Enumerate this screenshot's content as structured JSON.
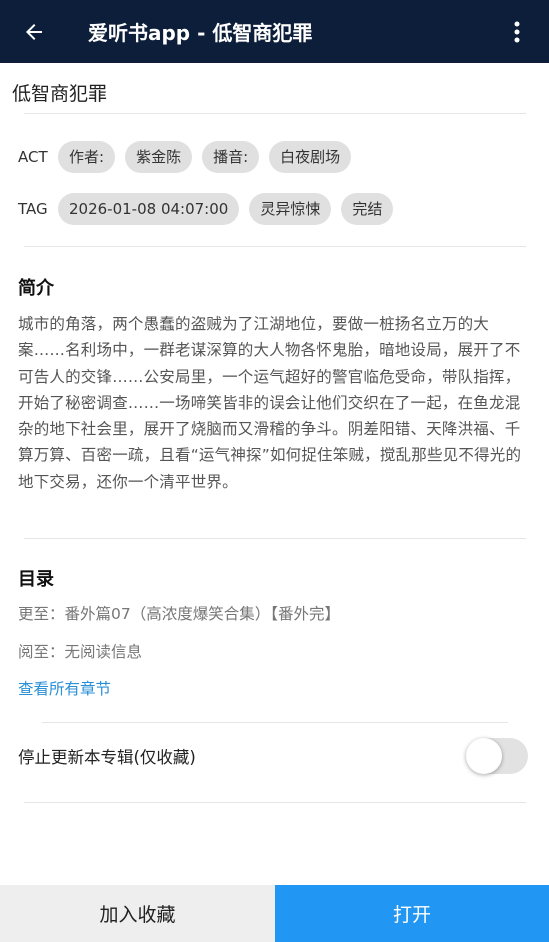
{
  "appbar": {
    "title": "爱听书app - 低智商犯罪",
    "back_icon": "arrow-left-icon",
    "more_icon": "more-vertical-icon"
  },
  "book": {
    "title": "低智商犯罪"
  },
  "act_row": {
    "label": "ACT",
    "chips": [
      "作者:",
      "紫金陈",
      "播音:",
      "白夜剧场"
    ]
  },
  "tag_row": {
    "label": "TAG",
    "chips": [
      "2026-01-08 04:07:00",
      "灵异惊悚",
      "完结"
    ]
  },
  "intro": {
    "title": "简介",
    "text": "城市的角落，两个愚蠢的盗贼为了江湖地位，要做一桩扬名立万的大案……名利场中，一群老谋深算的大人物各怀鬼胎，暗地设局，展开了不可告人的交锋……公安局里，一个运气超好的警官临危受命，带队指挥，开始了秘密调查……一场啼笑皆非的误会让他们交织在了一起，在鱼龙混杂的地下社会里，展开了烧脑而又滑稽的争斗。阴差阳错、天降洪福、千算万算、百密一疏，且看“运气神探”如何捉住笨贼，搅乱那些见不得光的地下交易，还你一个清平世界。"
  },
  "catalog": {
    "title": "目录",
    "updated": "更至：番外篇07（高浓度爆笑合集）【番外完】",
    "read": "阅至：无阅读信息",
    "view_all": "查看所有章节"
  },
  "toggle": {
    "label": "停止更新本专辑(仅收藏)",
    "on": false
  },
  "bottom": {
    "collect_label": "加入收藏",
    "open_label": "打开"
  },
  "colors": {
    "appbar": "#0d1e3a",
    "accent": "#2196f3",
    "link": "#2a8fd6",
    "chip": "#e0e0e0"
  }
}
